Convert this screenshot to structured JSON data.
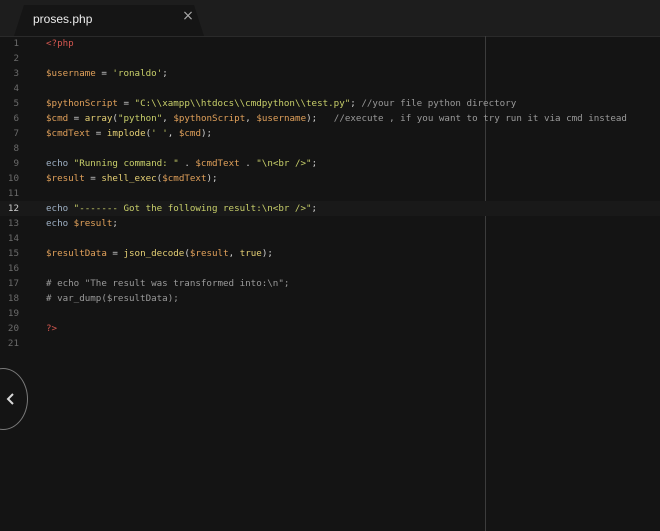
{
  "tab": {
    "title": "proses.php",
    "close_glyph": "×"
  },
  "colors": {
    "background": "#141414",
    "tag": "#d2564f",
    "variable": "#e0a05a",
    "string": "#c8cf6a",
    "function": "#e4cf74",
    "keyword": "#9eb0c4",
    "comment": "#9a9a9a"
  },
  "side_toggle": {
    "icon": "chevron-left-icon"
  },
  "current_line": 12,
  "editor": {
    "lines": [
      {
        "n": "1",
        "t": [
          [
            "tag",
            "<?php"
          ]
        ]
      },
      {
        "n": "2",
        "t": []
      },
      {
        "n": "3",
        "t": [
          [
            "var",
            "$username"
          ],
          [
            "op",
            " = "
          ],
          [
            "str",
            "'ronaldo'"
          ],
          [
            "op",
            ";"
          ]
        ]
      },
      {
        "n": "4",
        "t": []
      },
      {
        "n": "5",
        "t": [
          [
            "var",
            "$pythonScript"
          ],
          [
            "op",
            " = "
          ],
          [
            "str",
            "\"C:\\\\xampp\\\\htdocs\\\\cmdpython\\\\test.py\""
          ],
          [
            "op",
            "; "
          ],
          [
            "cm",
            "//your file python directory"
          ]
        ]
      },
      {
        "n": "6",
        "t": [
          [
            "var",
            "$cmd"
          ],
          [
            "op",
            " = "
          ],
          [
            "fn",
            "array"
          ],
          [
            "op",
            "("
          ],
          [
            "str",
            "\"python\""
          ],
          [
            "op",
            ", "
          ],
          [
            "var",
            "$pythonScript"
          ],
          [
            "op",
            ", "
          ],
          [
            "var",
            "$username"
          ],
          [
            "op",
            ");   "
          ],
          [
            "cm",
            "//execute , if you want to try run it via cmd instead"
          ]
        ]
      },
      {
        "n": "7",
        "t": [
          [
            "var",
            "$cmdText"
          ],
          [
            "op",
            " = "
          ],
          [
            "fn",
            "implode"
          ],
          [
            "op",
            "("
          ],
          [
            "str",
            "' '"
          ],
          [
            "op",
            ", "
          ],
          [
            "var",
            "$cmd"
          ],
          [
            "op",
            ");"
          ]
        ]
      },
      {
        "n": "8",
        "t": []
      },
      {
        "n": "9",
        "t": [
          [
            "kw",
            "echo "
          ],
          [
            "str",
            "\"Running command: \""
          ],
          [
            "op",
            " . "
          ],
          [
            "var",
            "$cmdText"
          ],
          [
            "op",
            " . "
          ],
          [
            "str",
            "\"\\n<br />\""
          ],
          [
            "op",
            ";"
          ]
        ]
      },
      {
        "n": "10",
        "t": [
          [
            "var",
            "$result"
          ],
          [
            "op",
            " = "
          ],
          [
            "fn",
            "shell_exec"
          ],
          [
            "op",
            "("
          ],
          [
            "var",
            "$cmdText"
          ],
          [
            "op",
            ");"
          ]
        ]
      },
      {
        "n": "11",
        "t": []
      },
      {
        "n": "12",
        "t": [
          [
            "kw",
            "echo "
          ],
          [
            "str",
            "\"------- Got the following result:\\n<br />\""
          ],
          [
            "op",
            ";"
          ]
        ]
      },
      {
        "n": "13",
        "t": [
          [
            "kw",
            "echo "
          ],
          [
            "var",
            "$result"
          ],
          [
            "op",
            ";"
          ]
        ]
      },
      {
        "n": "14",
        "t": []
      },
      {
        "n": "15",
        "t": [
          [
            "var",
            "$resultData"
          ],
          [
            "op",
            " = "
          ],
          [
            "fn",
            "json_decode"
          ],
          [
            "op",
            "("
          ],
          [
            "var",
            "$result"
          ],
          [
            "op",
            ", "
          ],
          [
            "fn",
            "true"
          ],
          [
            "op",
            ");"
          ]
        ]
      },
      {
        "n": "16",
        "t": []
      },
      {
        "n": "17",
        "t": [
          [
            "cm",
            "# echo \"The result was transformed into:\\n\";"
          ]
        ]
      },
      {
        "n": "18",
        "t": [
          [
            "cm",
            "# var_dump($resultData);"
          ]
        ]
      },
      {
        "n": "19",
        "t": []
      },
      {
        "n": "20",
        "t": [
          [
            "tag",
            "?>"
          ]
        ]
      },
      {
        "n": "21",
        "t": []
      }
    ]
  }
}
